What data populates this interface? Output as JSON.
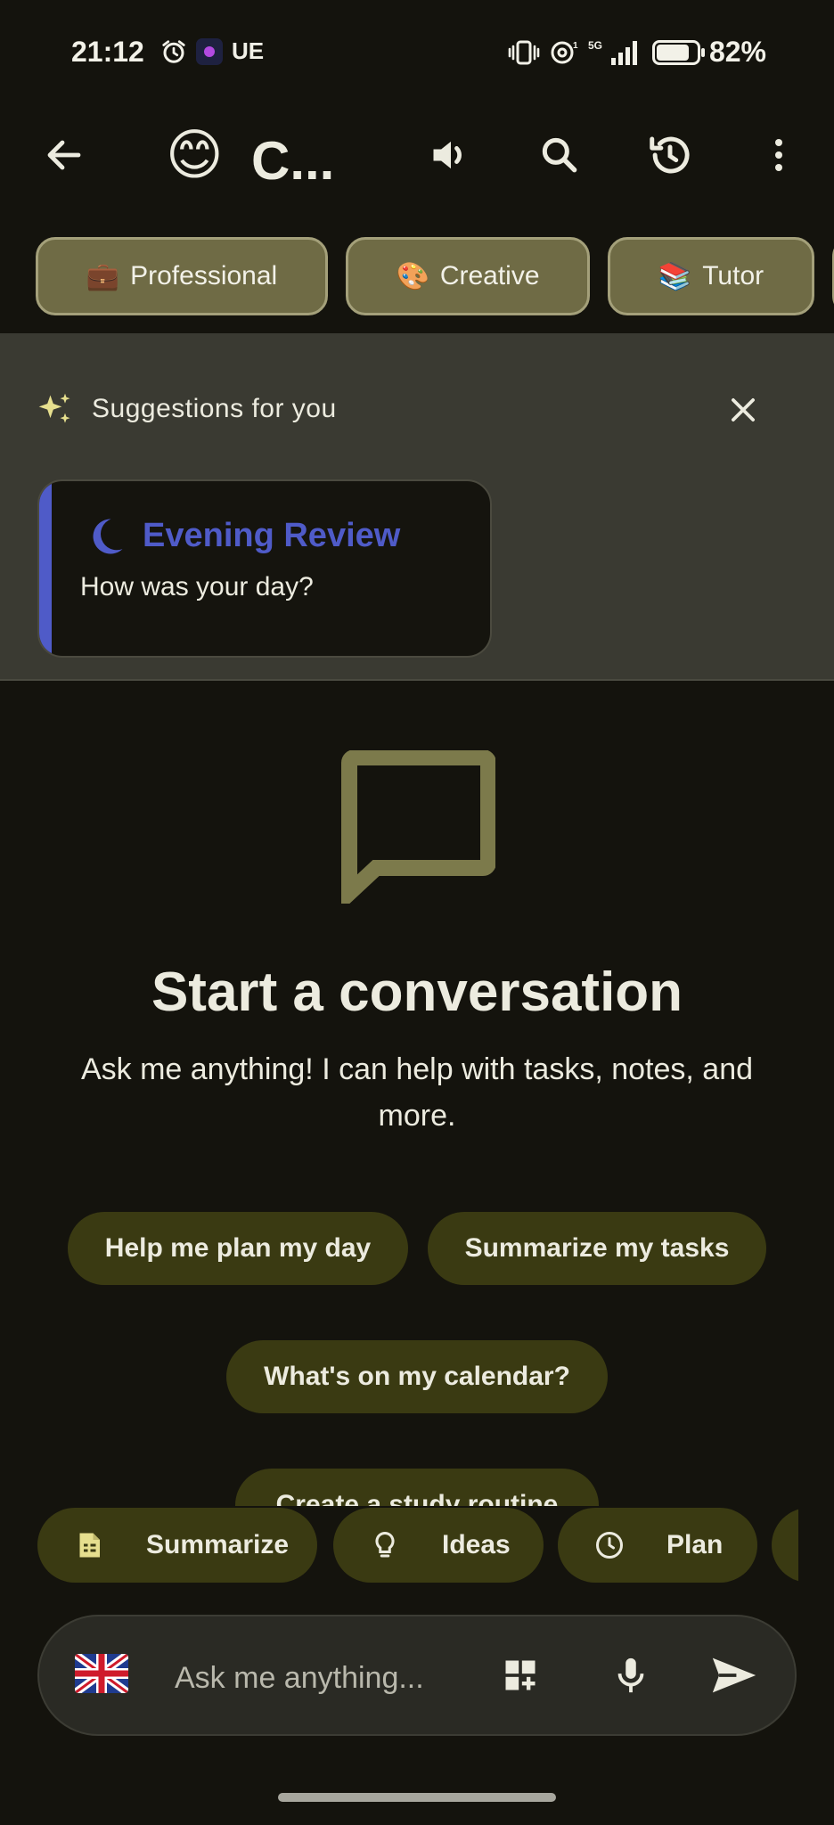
{
  "status_bar": {
    "time": "21:12",
    "carrier": "UE",
    "network": "5G",
    "battery_percent": "82%",
    "battery_level": 0.82
  },
  "app_bar": {
    "title_emoji": "😊",
    "title": "C...",
    "icons": [
      "back-arrow-icon",
      "speaker-icon",
      "search-icon",
      "history-icon",
      "more-vertical-icon"
    ]
  },
  "personas": [
    {
      "emoji": "💼",
      "label": "Professional"
    },
    {
      "emoji": "🎨",
      "label": "Creative"
    },
    {
      "emoji": "📚",
      "label": "Tutor"
    }
  ],
  "suggestions": {
    "title": "Suggestions for you",
    "card": {
      "title": "Evening Review",
      "subtitle": "How was your day?",
      "accent_color": "#4f5bc8"
    }
  },
  "empty_state": {
    "title": "Start a conversation",
    "subtitle": "Ask me anything! I can help with tasks, notes, and more."
  },
  "prompt_chips": [
    "Help me plan my day",
    "Summarize my tasks",
    "What's on my calendar?",
    "Create a study routine"
  ],
  "quick_actions": [
    {
      "icon": "document-icon",
      "label": "Summarize"
    },
    {
      "icon": "lightbulb-icon",
      "label": "Ideas"
    },
    {
      "icon": "clock-icon",
      "label": "Plan"
    }
  ],
  "input": {
    "placeholder": "Ask me anything...",
    "value": ""
  },
  "colors": {
    "background": "#14130d",
    "chip": "#3a3a12",
    "persona_chip": "#6f6b45",
    "accent_blue": "#4f5bc8",
    "olive_icon": "#7c7a4b"
  }
}
